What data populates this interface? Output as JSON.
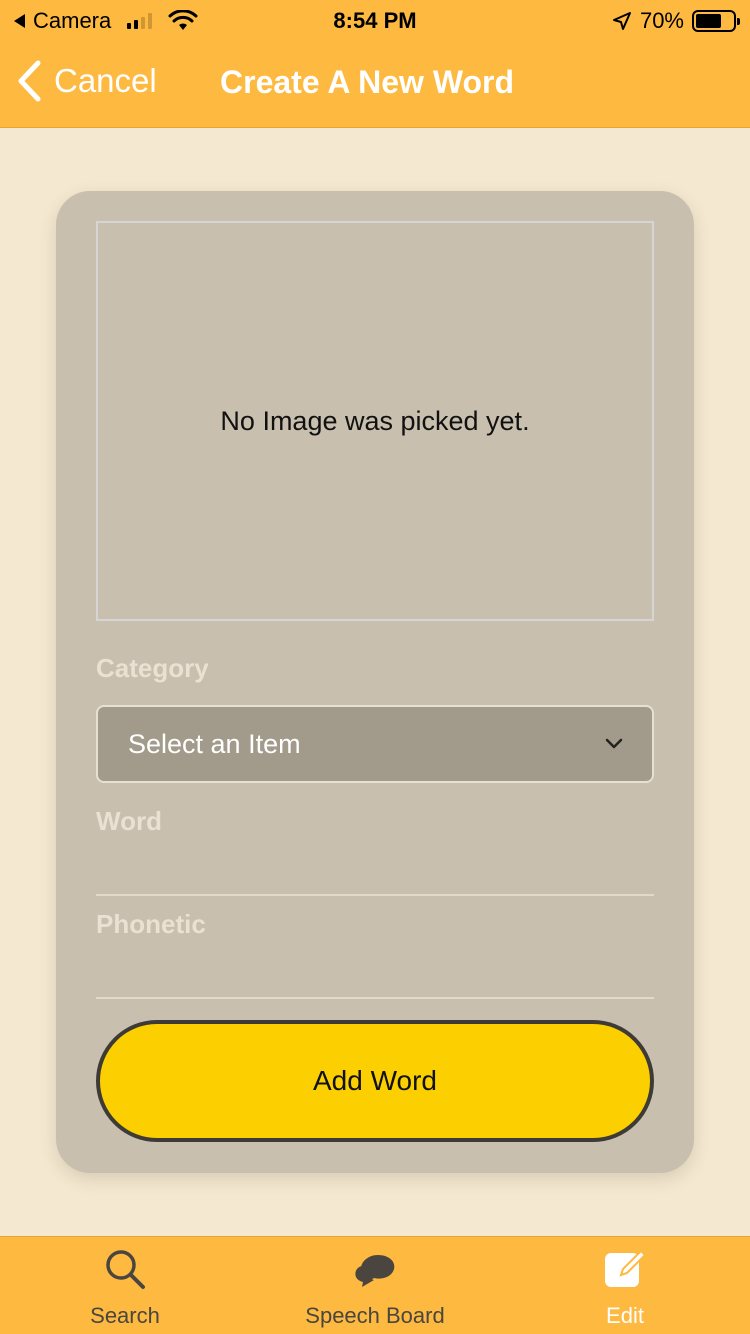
{
  "status_bar": {
    "back_app": "Camera",
    "time": "8:54 PM",
    "battery": "70%",
    "battery_level": 0.7
  },
  "nav": {
    "back_label": "Cancel",
    "title": "Create A New Word"
  },
  "form": {
    "image_placeholder": "No Image was picked yet.",
    "category_label": "Category",
    "category_value": "Select an Item",
    "word_label": "Word",
    "word_value": "",
    "phonetic_label": "Phonetic",
    "phonetic_value": "",
    "submit_label": "Add Word"
  },
  "tabs": [
    {
      "label": "Search",
      "icon": "search-icon",
      "active": false
    },
    {
      "label": "Speech Board",
      "icon": "speech-bubbles-icon",
      "active": false
    },
    {
      "label": "Edit",
      "icon": "edit-icon",
      "active": true
    }
  ],
  "colors": {
    "accent": "#fdb940",
    "background": "#f5e8d0",
    "card": "#c8bfae",
    "button": "#fbcf00"
  }
}
